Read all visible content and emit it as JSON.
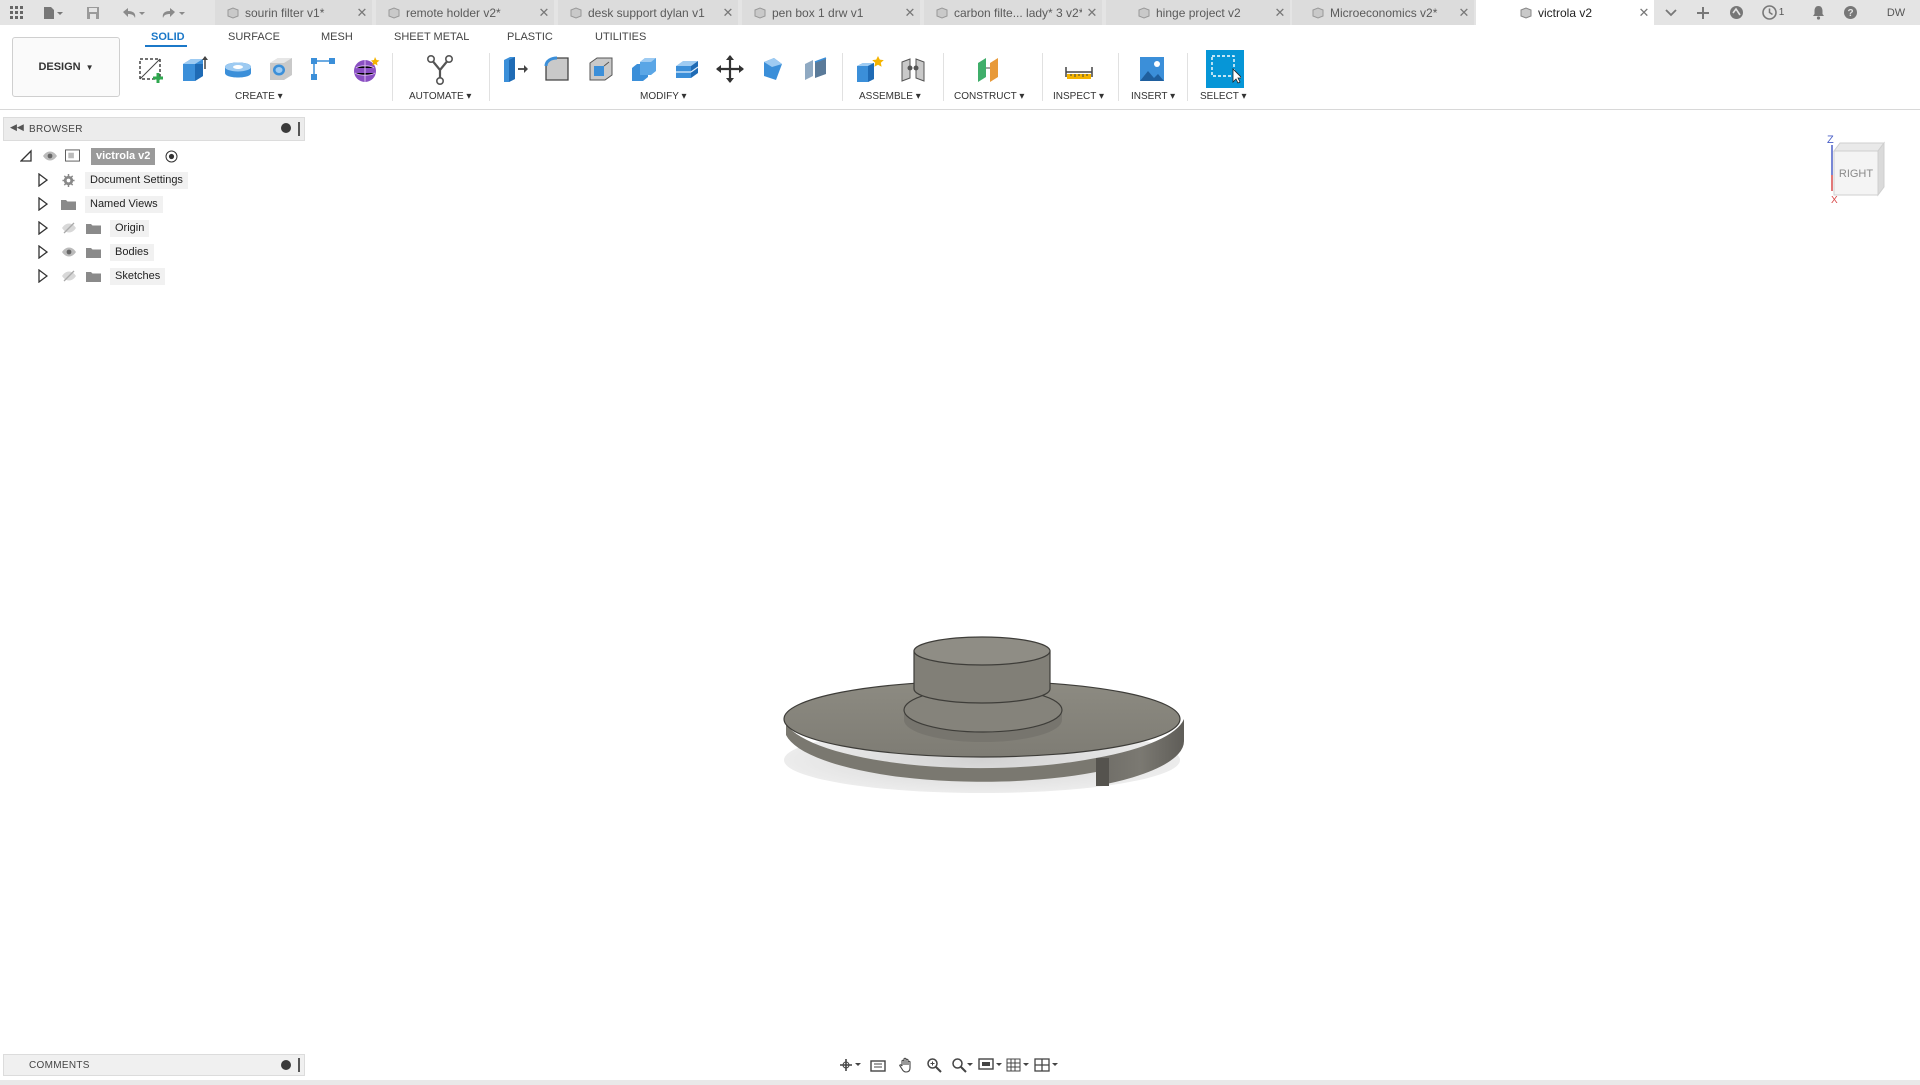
{
  "tabs": [
    {
      "label": "sourin filter v1*"
    },
    {
      "label": "remote holder v2*"
    },
    {
      "label": "desk support dylan v1"
    },
    {
      "label": "pen box 1 drw v1"
    },
    {
      "label": "carbon filte... lady* 3 v2*"
    },
    {
      "label": "hinge project v2"
    },
    {
      "label": "Microeconomics v2*"
    },
    {
      "label": "victrola v2"
    }
  ],
  "tabbar_right": {
    "job_count": "1",
    "user_initials": "DW"
  },
  "workspace": {
    "label": "DESIGN"
  },
  "workspace_tabs": [
    "SOLID",
    "SURFACE",
    "MESH",
    "SHEET METAL",
    "PLASTIC",
    "UTILITIES"
  ],
  "groups": {
    "create": "CREATE",
    "automate": "AUTOMATE",
    "modify": "MODIFY",
    "assemble": "ASSEMBLE",
    "construct": "CONSTRUCT",
    "inspect": "INSPECT",
    "insert": "INSERT",
    "select": "SELECT"
  },
  "browser": {
    "title": "BROWSER",
    "root": "victrola v2",
    "nodes": [
      "Document Settings",
      "Named Views",
      "Origin",
      "Bodies",
      "Sketches"
    ]
  },
  "viewcube": {
    "face": "RIGHT",
    "axis_z": "Z",
    "axis_x": "X"
  },
  "comments": {
    "title": "COMMENTS"
  },
  "colors": {
    "accent": "#1b78c8",
    "select_blue": "#0696d7",
    "body_gray": "#8a8880"
  }
}
